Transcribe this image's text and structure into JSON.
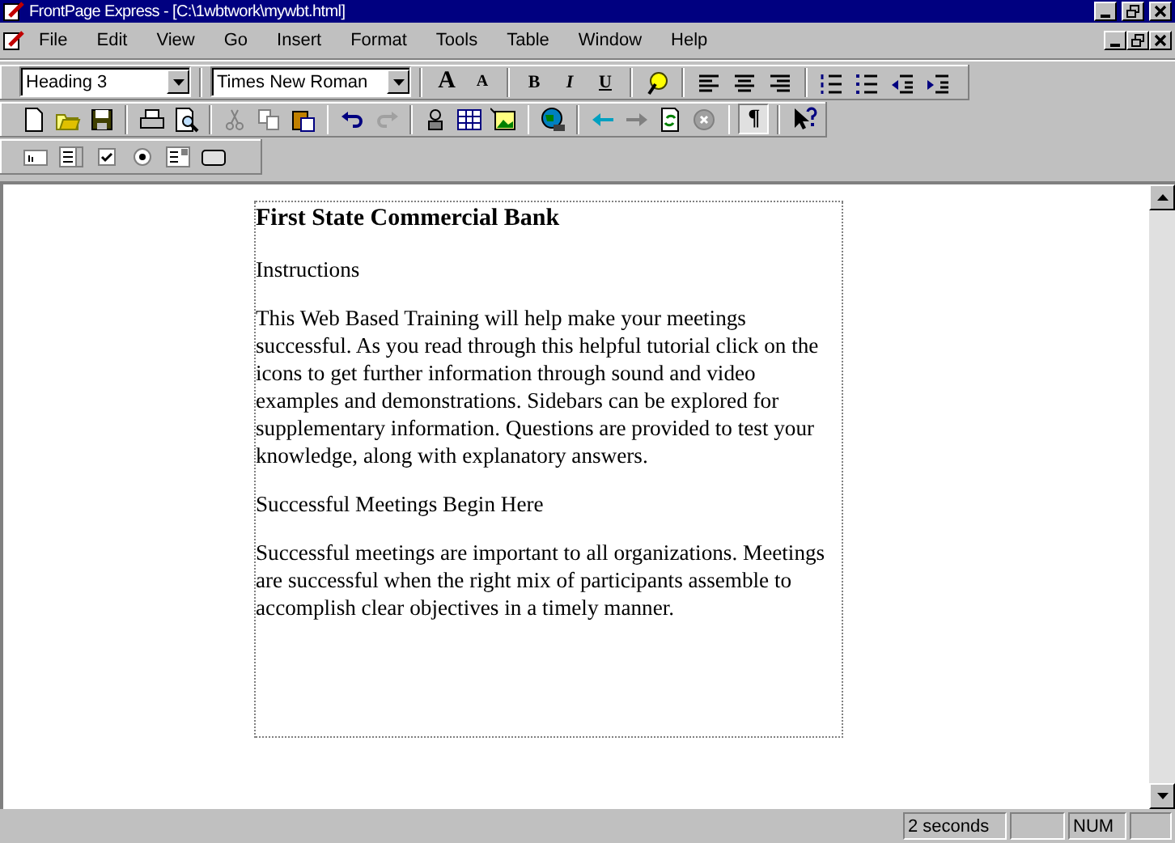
{
  "window": {
    "title": "FrontPage Express - [C:\\1wbtwork\\mywbt.html]"
  },
  "menu": [
    "File",
    "Edit",
    "View",
    "Go",
    "Insert",
    "Format",
    "Tools",
    "Table",
    "Window",
    "Help"
  ],
  "format_toolbar": {
    "style": "Heading 3",
    "font": "Times New Roman",
    "size_buttons": [
      "A",
      "A"
    ],
    "style_buttons": [
      "B",
      "I",
      "U"
    ]
  },
  "standard_toolbar": {
    "show_all": {
      "label": "¶",
      "pressed": true
    }
  },
  "document": {
    "heading": "First State Commercial Bank",
    "paragraphs": [
      "Instructions",
      "This Web Based Training will help make your meetings successful. As you read through this helpful tutorial click on the icons to get further information through sound and video examples and demonstrations. Sidebars can be explored for supplementary information. Questions are provided to test your knowledge, along with explanatory answers.",
      "Successful Meetings Begin Here",
      "Successful meetings are important to all organizations. Meetings are successful when the right mix of participants assemble to accomplish clear objectives in a timely manner."
    ]
  },
  "status_bar": {
    "message": "2 seconds",
    "num": "NUM"
  }
}
